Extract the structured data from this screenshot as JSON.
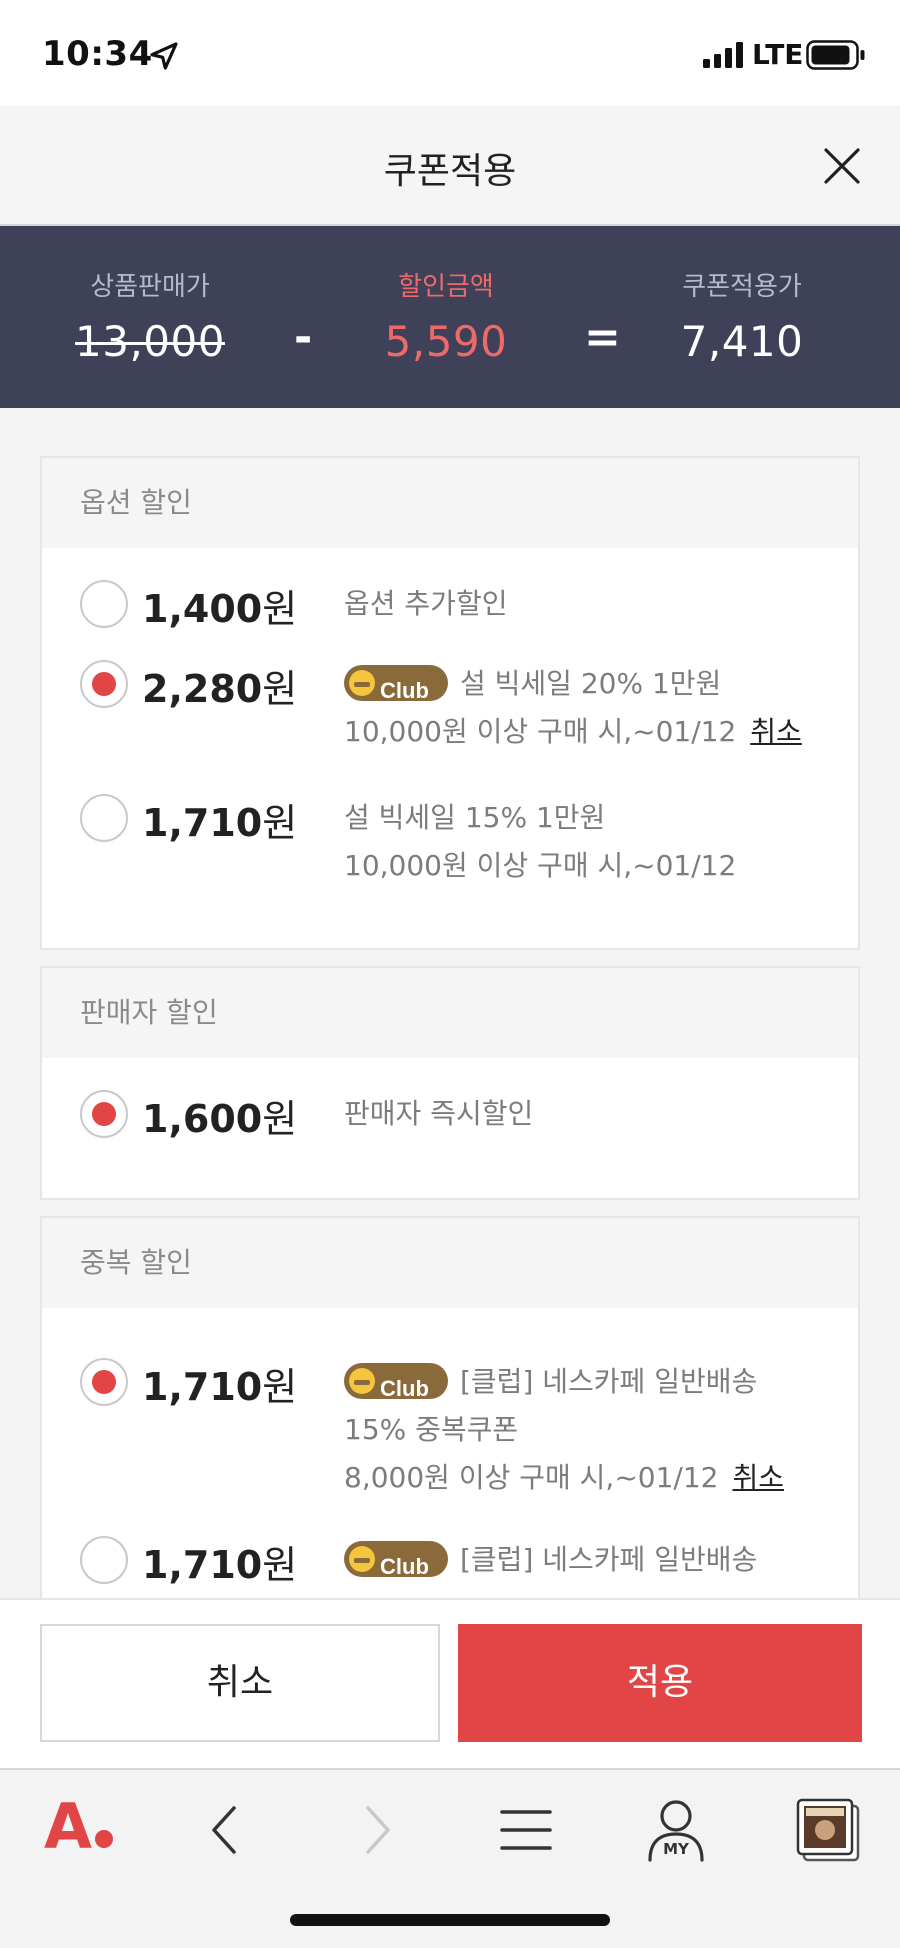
{
  "status_bar": {
    "time": "10:34",
    "network": "LTE"
  },
  "header": {
    "title": "쿠폰적용"
  },
  "summary": {
    "price_label": "상품판매가",
    "price_value": "13,000",
    "minus": "-",
    "discount_label": "할인금액",
    "discount_value": "5,590",
    "equals": "=",
    "final_label": "쿠폰적용가",
    "final_value": "7,410"
  },
  "sections": {
    "option": {
      "title": "옵션 할인",
      "items": [
        {
          "amount": "1,400",
          "unit": "원",
          "selected": false,
          "club": false,
          "line1": "옵션 추가할인"
        },
        {
          "amount": "2,280",
          "unit": "원",
          "selected": true,
          "club": true,
          "line1": "설 빅세일 20% 1만원",
          "line2": "10,000원 이상 구매 시,~01/12",
          "cancel": "취소"
        },
        {
          "amount": "1,710",
          "unit": "원",
          "selected": false,
          "club": false,
          "line1": "설 빅세일 15% 1만원",
          "line2": "10,000원 이상 구매 시,~01/12"
        }
      ]
    },
    "seller": {
      "title": "판매자 할인",
      "items": [
        {
          "amount": "1,600",
          "unit": "원",
          "selected": true,
          "club": false,
          "line1": "판매자 즉시할인"
        }
      ]
    },
    "duplicate": {
      "title": "중복 할인",
      "items": [
        {
          "amount": "1,710",
          "unit": "원",
          "selected": true,
          "club": true,
          "line1": "[클럽] 네스카페 일반배송",
          "line2": "15% 중복쿠폰",
          "line3": "8,000원 이상 구매 시,~01/12",
          "cancel": "취소"
        },
        {
          "amount": "1,710",
          "unit": "원",
          "selected": false,
          "club": true,
          "line1": "[클럽] 네스카페 일반배송"
        }
      ]
    }
  },
  "badge": {
    "club_text": "Club"
  },
  "actions": {
    "cancel_label": "취소",
    "apply_label": "적용"
  },
  "bottom_nav": {
    "logo_letter": "A",
    "my_label": "MY"
  },
  "colors": {
    "accent": "#e24545",
    "summary_bg": "#3e4157",
    "club_badge": "#8a6a3a"
  }
}
